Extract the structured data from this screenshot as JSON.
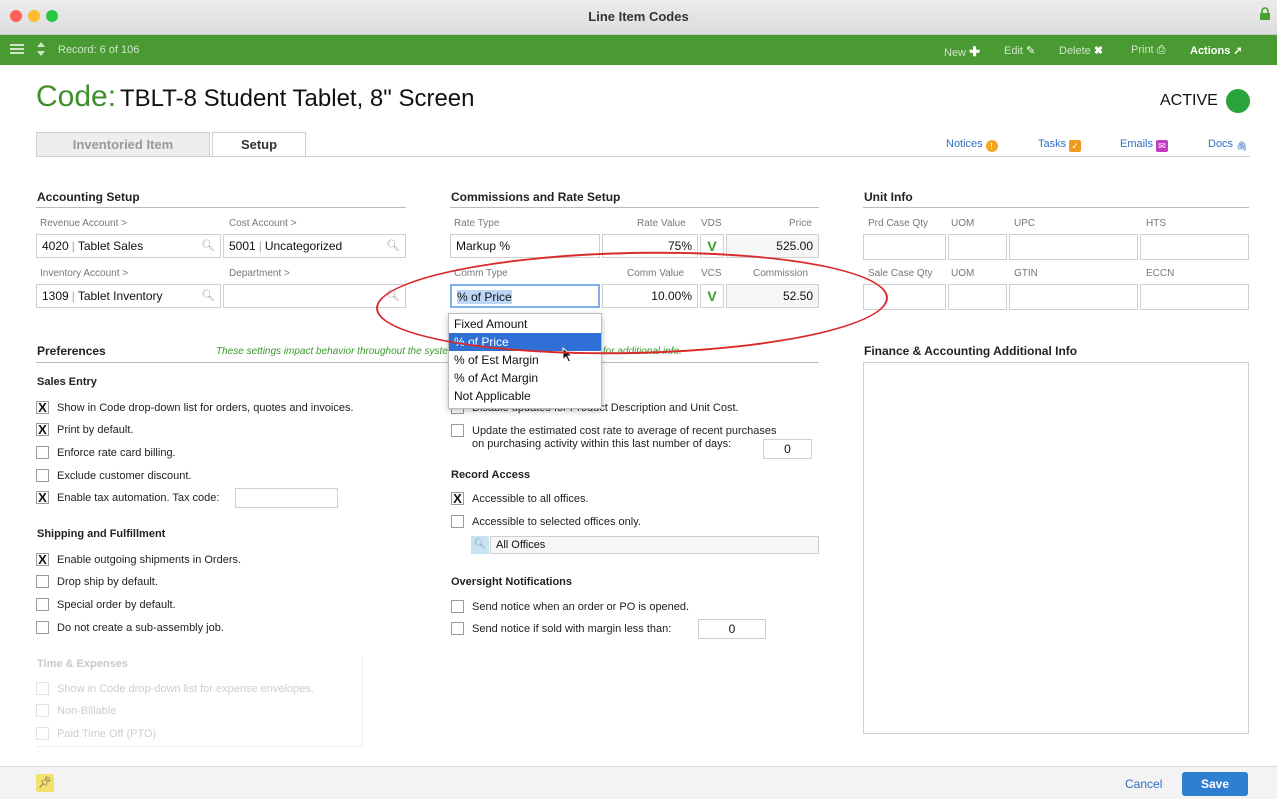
{
  "window": {
    "title": "Line Item Codes"
  },
  "toolbar": {
    "record": "Record: 6 of 106",
    "new": "New",
    "edit": "Edit",
    "delete": "Delete",
    "print": "Print",
    "actions": "Actions"
  },
  "header": {
    "code_label": "Code:",
    "code_value": "TBLT-8 Student Tablet, 8\" Screen",
    "status": "ACTIVE"
  },
  "tabs": [
    {
      "label": "Inventoried Item"
    },
    {
      "label": "Setup"
    }
  ],
  "links": {
    "notices": "Notices",
    "tasks": "Tasks",
    "emails": "Emails",
    "docs": "Docs"
  },
  "accounting": {
    "title": "Accounting Setup",
    "revenue_label": "Revenue Account >",
    "revenue_code": "4020",
    "revenue_name": "Tablet Sales",
    "cost_label": "Cost Account >",
    "cost_code": "5001",
    "cost_name": "Uncategorized",
    "inventory_label": "Inventory Account >",
    "inventory_code": "1309",
    "inventory_name": "Tablet Inventory",
    "department_label": "Department >",
    "department_value": ""
  },
  "commissions": {
    "title": "Commissions and Rate Setup",
    "rate_type_label": "Rate Type",
    "rate_value_label": "Rate Value",
    "vds_label": "VDS",
    "price_label": "Price",
    "rate_type": "Markup %",
    "rate_value": "75%",
    "vds_mark": "V",
    "price": "525.00",
    "comm_type_label": "Comm Type",
    "comm_value_label": "Comm Value",
    "vcs_label": "VCS",
    "commission_label": "Commission",
    "comm_type": "% of Price",
    "comm_value": "10.00%",
    "vcs_mark": "V",
    "commission": "52.50",
    "options": [
      "Fixed Amount",
      "% of Price",
      "% of Est Margin",
      "% of Act Margin",
      "Not Applicable"
    ]
  },
  "unit_info": {
    "title": "Unit Info",
    "prd_case_qty": "Prd Case Qty",
    "uom1": "UOM",
    "upc": "UPC",
    "hts": "HTS",
    "sale_case_qty": "Sale Case Qty",
    "uom2": "UOM",
    "gtin": "GTIN",
    "eccn": "ECCN"
  },
  "preferences": {
    "title": "Preferences",
    "note": "These settings impact behavior throughout the system. See the aACE knowledge base for additional info.",
    "sales_entry": "Sales Entry",
    "sales_items": [
      {
        "label": "Show in Code drop-down list for orders, quotes and invoices.",
        "mark": "X"
      },
      {
        "label": "Print by default.",
        "mark": "X"
      },
      {
        "label": "Enforce rate card billing.",
        "mark": ""
      },
      {
        "label": "Exclude customer discount.",
        "mark": ""
      },
      {
        "label": "Enable tax automation. Tax code:",
        "mark": "X"
      }
    ],
    "tax_code": "",
    "shipping": "Shipping and Fulfillment",
    "shipping_items": [
      {
        "label": "Enable outgoing shipments in Orders.",
        "mark": "X"
      },
      {
        "label": "Drop ship by default.",
        "mark": ""
      },
      {
        "label": "Special order by default.",
        "mark": ""
      },
      {
        "label": "Do not create a sub-assembly job.",
        "mark": ""
      }
    ],
    "time": "Time & Expenses",
    "time_items": [
      {
        "label": "Show in Code drop-down list for expense envelopes.",
        "mark": ""
      },
      {
        "label": "Non-Billable",
        "mark": ""
      },
      {
        "label": "Paid Time Off (PTO)",
        "mark": ""
      }
    ]
  },
  "purchasing": {
    "items": [
      {
        "label": "Disable updates for Product Description and Unit Cost.",
        "mark": ""
      },
      {
        "label": "Update the estimated cost rate to average of recent purchases",
        "label2": "on purchasing activity within this last number of days:",
        "mark": ""
      }
    ],
    "days": "0"
  },
  "record_access": {
    "title": "Record Access",
    "items": [
      {
        "label": "Accessible to all offices.",
        "mark": "X"
      },
      {
        "label": "Accessible to selected offices only.",
        "mark": ""
      }
    ],
    "offices": "All Offices"
  },
  "oversight": {
    "title": "Oversight Notifications",
    "items": [
      {
        "label": "Send notice when an order or PO is opened.",
        "mark": ""
      },
      {
        "label": "Send notice if sold with margin less than:",
        "mark": ""
      }
    ],
    "margin": "0"
  },
  "finance": {
    "title": "Finance & Accounting Additional Info"
  },
  "footer": {
    "cancel": "Cancel",
    "save": "Save"
  },
  "colors": {
    "accent": "#4a9a33",
    "link": "#2f6fbf",
    "active": "#2aa33a",
    "annotation": "#d92a2a"
  }
}
